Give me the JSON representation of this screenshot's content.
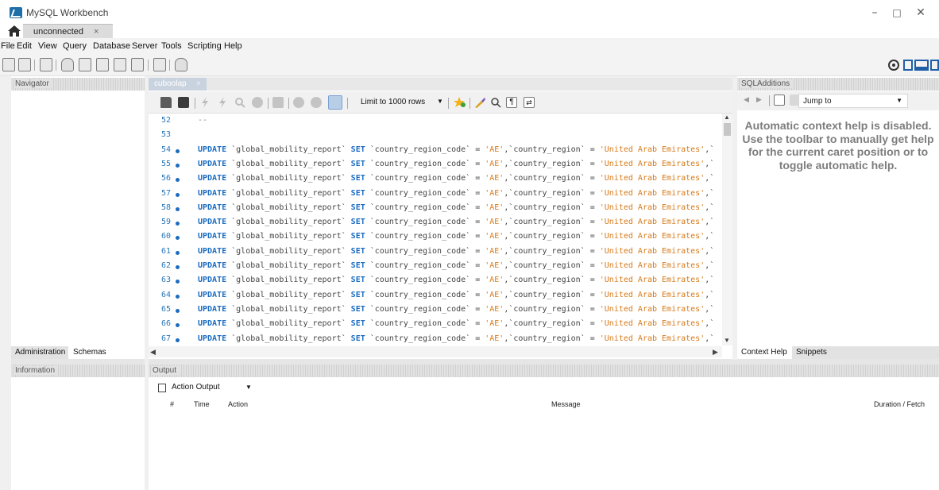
{
  "window": {
    "title": "MySQL Workbench",
    "minimize": "–",
    "maximize": "□",
    "close": "✕"
  },
  "connection_tab": {
    "label": "unconnected",
    "close": "×"
  },
  "menu": [
    "File",
    "Edit",
    "View",
    "Query",
    "Database",
    "Server",
    "Tools",
    "Scripting",
    "Help"
  ],
  "navigator": {
    "title": "Navigator",
    "tabs": [
      "Administration",
      "Schemas"
    ],
    "active_tab": "Schemas"
  },
  "information": {
    "title": "Information"
  },
  "editor": {
    "tab_label": "cuboolap",
    "tab_close": "×",
    "limit_label": "Limit to 1000 rows",
    "lines": [
      {
        "num": "52",
        "text": "--",
        "dot": false
      },
      {
        "num": "53",
        "text": "",
        "dot": false
      },
      {
        "num": "54",
        "dot": true
      },
      {
        "num": "55",
        "dot": true
      },
      {
        "num": "56",
        "dot": true
      },
      {
        "num": "57",
        "dot": true
      },
      {
        "num": "58",
        "dot": true
      },
      {
        "num": "59",
        "dot": true
      },
      {
        "num": "60",
        "dot": true
      },
      {
        "num": "61",
        "dot": true
      },
      {
        "num": "62",
        "dot": true
      },
      {
        "num": "63",
        "dot": true
      },
      {
        "num": "64",
        "dot": true
      },
      {
        "num": "65",
        "dot": true
      },
      {
        "num": "66",
        "dot": true
      },
      {
        "num": "67",
        "dot": true
      }
    ],
    "update_statement": {
      "kw_update": "UPDATE",
      "table": " `global_mobility_report` ",
      "kw_set": "SET",
      "col1": " `country_region_code` = ",
      "val1": "'AE'",
      "col2": ",`country_region` = ",
      "val2": "'United Arab Emirates'",
      "tail": ",`"
    }
  },
  "sql_additions": {
    "title": "SQLAdditions",
    "jump_to": "Jump to",
    "help_text": "Automatic context help is disabled. Use the toolbar to manually get help for the current caret position or to toggle automatic help.",
    "tabs": [
      "Context Help",
      "Snippets"
    ],
    "active_tab": "Context Help"
  },
  "output": {
    "title": "Output",
    "selector": "Action Output",
    "columns": [
      "#",
      "Time",
      "Action",
      "Message",
      "Duration / Fetch"
    ]
  },
  "colors": {
    "keyword": "#1b6cc0",
    "string": "#d67a1a",
    "help_text": "#7d7d7d"
  }
}
